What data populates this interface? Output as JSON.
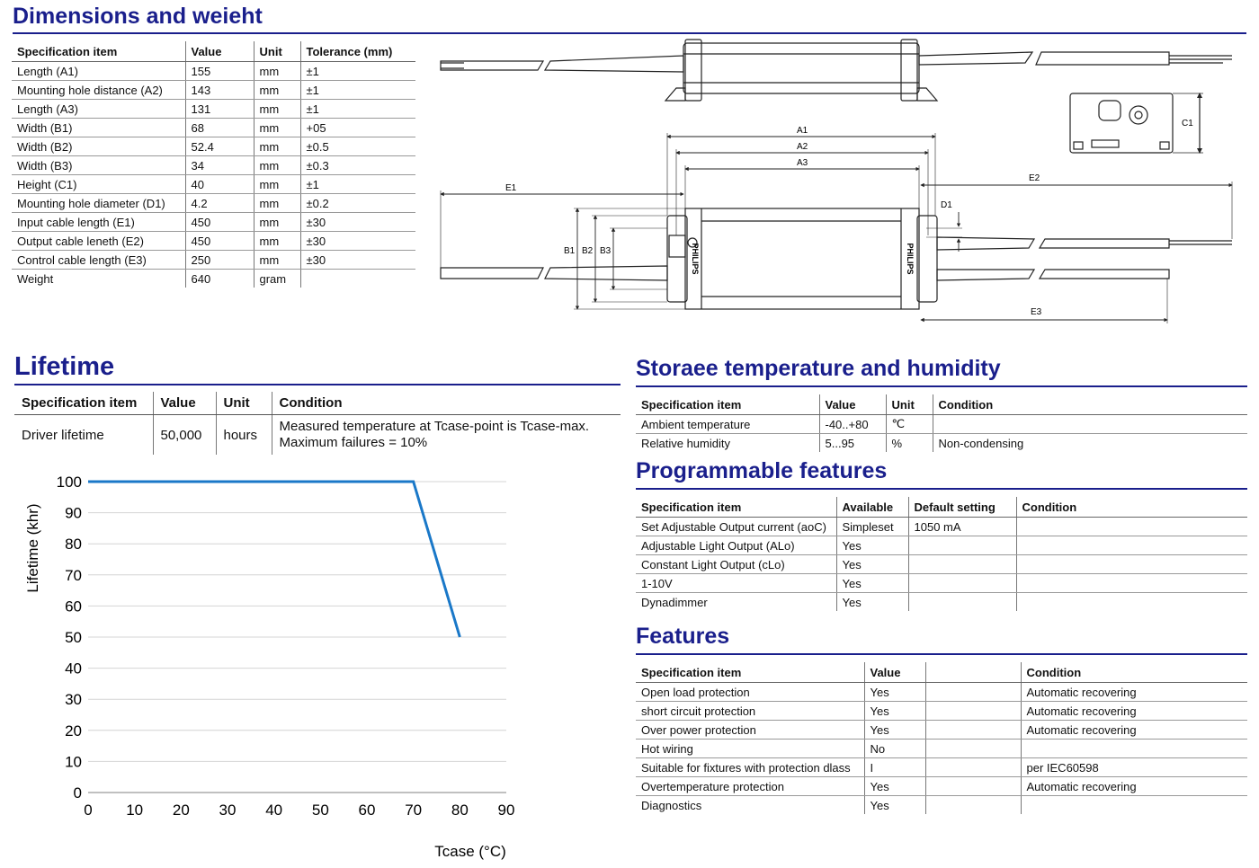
{
  "dimensions": {
    "title": "Dimensions and weieht",
    "headers": [
      "Specification item",
      "Value",
      "Unit",
      "Tolerance (mm)"
    ],
    "rows": [
      [
        "Length (A1)",
        "155",
        "mm",
        "±1"
      ],
      [
        "Mounting hole distance (A2)",
        "143",
        "mm",
        "±1"
      ],
      [
        "Length (A3)",
        "131",
        "mm",
        "±1"
      ],
      [
        "Width (B1)",
        "68",
        "mm",
        "+05"
      ],
      [
        "Width (B2)",
        "52.4",
        "mm",
        "±0.5"
      ],
      [
        "Width (B3)",
        "34",
        "mm",
        "±0.3"
      ],
      [
        "Height (C1)",
        "40",
        "mm",
        "±1"
      ],
      [
        "Mounting hole diameter (D1)",
        "4.2",
        "mm",
        "±0.2"
      ],
      [
        "Input cable length (E1)",
        "450",
        "mm",
        "±30"
      ],
      [
        "Output cable leneth (E2)",
        "450",
        "mm",
        "±30"
      ],
      [
        "Control cable length (E3)",
        "250",
        "mm",
        "±30"
      ],
      [
        "Weight",
        "640",
        "gram",
        ""
      ]
    ]
  },
  "drawing": {
    "labels": {
      "A1": "A1",
      "A2": "A2",
      "A3": "A3",
      "B1": "B1",
      "B2": "B2",
      "B3": "B3",
      "C1": "C1",
      "D1": "D1",
      "E1": "E1",
      "E2": "E2",
      "E3": "E3"
    },
    "brand": "PHILIPS"
  },
  "lifetime": {
    "title": "Lifetime",
    "headers": [
      "Specification item",
      "Value",
      "Unit",
      "Condition"
    ],
    "row": {
      "item": "Driver lifetime",
      "value": "50,000",
      "unit": "hours",
      "condition_line1": "Measured temperature at Tcase-point is Tcase-max.",
      "condition_line2": "Maximum failures = 10%"
    }
  },
  "chart_data": {
    "type": "line",
    "xlabel": "Tcase (°C)",
    "ylabel": "Lifetime (khr)",
    "xlim": [
      0,
      90
    ],
    "ylim": [
      0,
      100
    ],
    "xticks": [
      0,
      10,
      20,
      30,
      40,
      50,
      60,
      70,
      80,
      90
    ],
    "yticks": [
      0,
      10,
      20,
      30,
      40,
      50,
      60,
      70,
      80,
      90,
      100
    ],
    "grid": true,
    "line_color": "#1a78c8",
    "series": [
      {
        "x": [
          0,
          70,
          80
        ],
        "y": [
          100,
          100,
          50
        ]
      }
    ]
  },
  "storage": {
    "title": "Storaee temperature and humidity",
    "headers": [
      "Specification item",
      "Value",
      "Unit",
      "Condition"
    ],
    "rows": [
      [
        "Ambient temperature",
        "-40..+80",
        "℃",
        ""
      ],
      [
        "Relative humidity",
        "5...95",
        "%",
        "Non-condensing"
      ]
    ]
  },
  "programmable": {
    "title": "Programmable features",
    "headers": [
      "Specification item",
      "Available",
      "Default setting",
      "Condition"
    ],
    "rows": [
      [
        "Set Adjustable Output current (aoC)",
        "Simpleset",
        "1050 mA",
        ""
      ],
      [
        "Adjustable Light Output (ALo)",
        "Yes",
        "",
        ""
      ],
      [
        "Constant Light Output (cLo)",
        "Yes",
        "",
        ""
      ],
      [
        "1-10V",
        "Yes",
        "",
        ""
      ],
      [
        "Dynadimmer",
        "Yes",
        "",
        ""
      ]
    ]
  },
  "features": {
    "title": "Features",
    "headers": [
      "Specification item",
      "Value",
      "",
      "Condition"
    ],
    "rows": [
      [
        "Open load protection",
        "Yes",
        "",
        "Automatic recovering"
      ],
      [
        "short circuit protection",
        "Yes",
        "",
        "Automatic recovering"
      ],
      [
        "Over power protection",
        "Yes",
        "",
        "Automatic recovering"
      ],
      [
        "Hot wiring",
        "No",
        "",
        ""
      ],
      [
        "Suitable for fixtures with protection dlass",
        "I",
        "",
        "per IEC60598"
      ],
      [
        "Overtemperature protection",
        "Yes",
        "",
        "Automatic recovering"
      ],
      [
        "Diagnostics",
        "Yes",
        "",
        ""
      ]
    ]
  },
  "colors": {
    "heading": "#1a1f8c",
    "chart_line": "#1a78c8"
  }
}
